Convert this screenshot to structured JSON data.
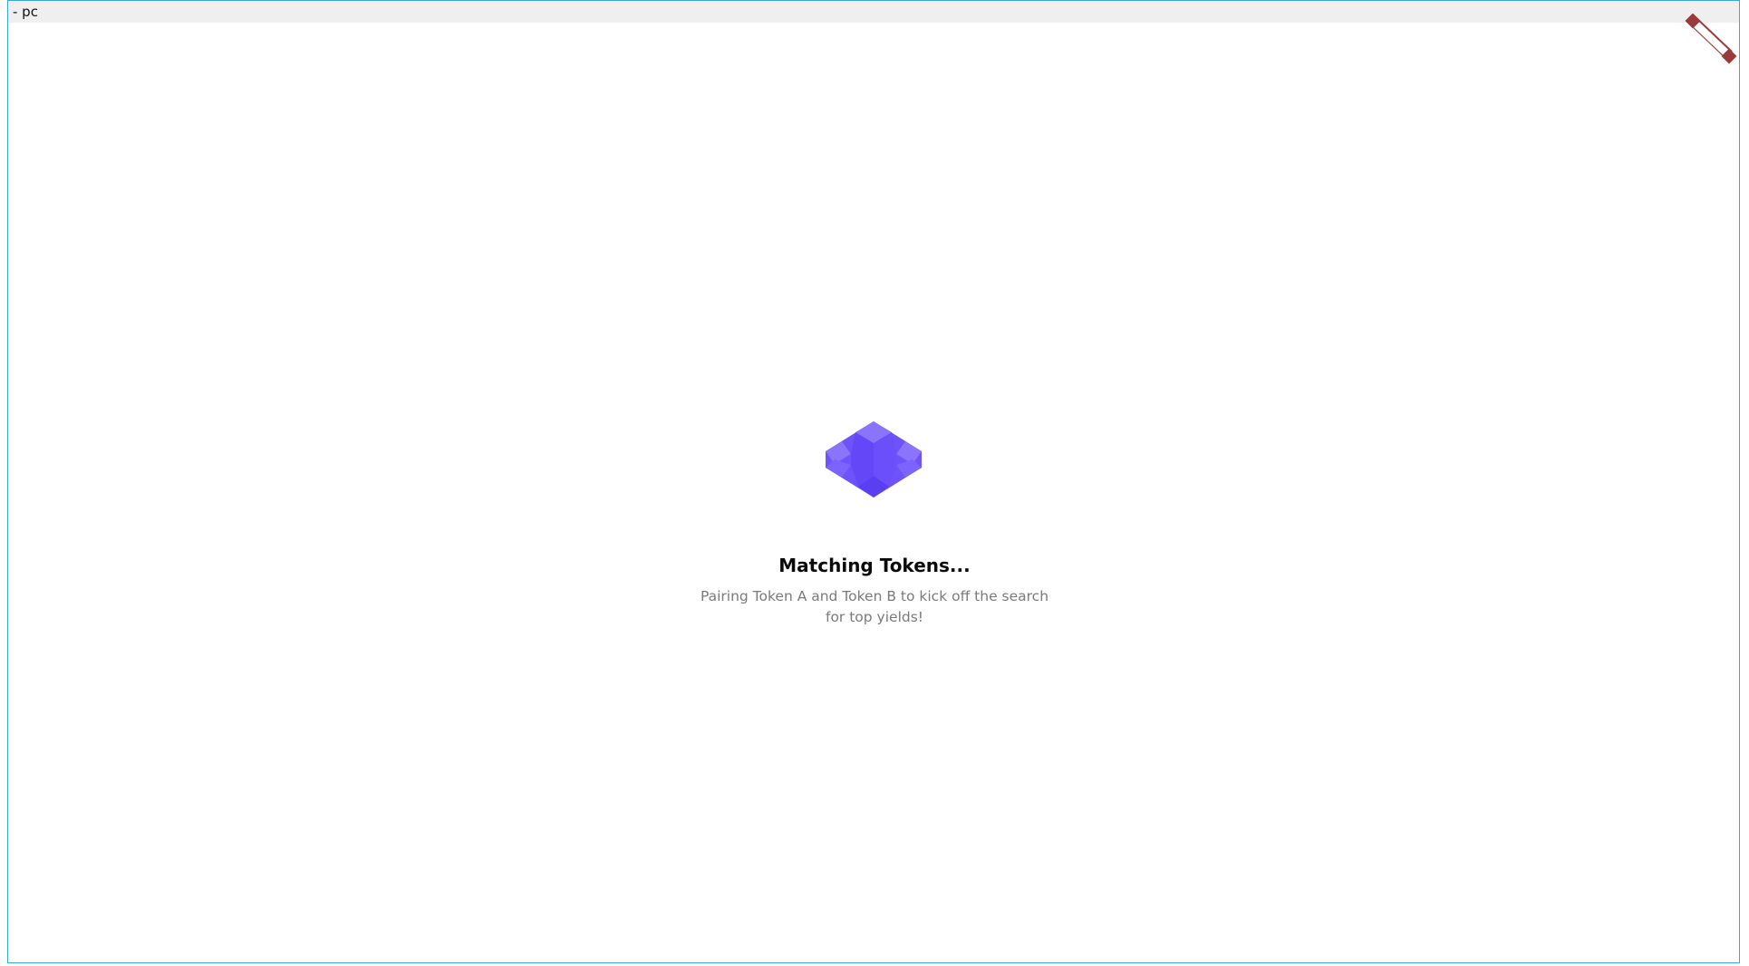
{
  "window": {
    "title": "- pc"
  },
  "loader": {
    "icon": "cube-logo-icon",
    "heading": "Matching Tokens...",
    "message": "Pairing Token A and Token B to kick off the search for top yields!"
  },
  "colors": {
    "frame_border": "#3aa6e0",
    "titlebar_bg": "#efefef",
    "logo_primary": "#6e52fb",
    "logo_light": "#8a74fc",
    "logo_dark": "#5a3ff0",
    "handle": "#9b3a3a",
    "heading": "#0b0b0b",
    "message": "#7a7a7a"
  }
}
